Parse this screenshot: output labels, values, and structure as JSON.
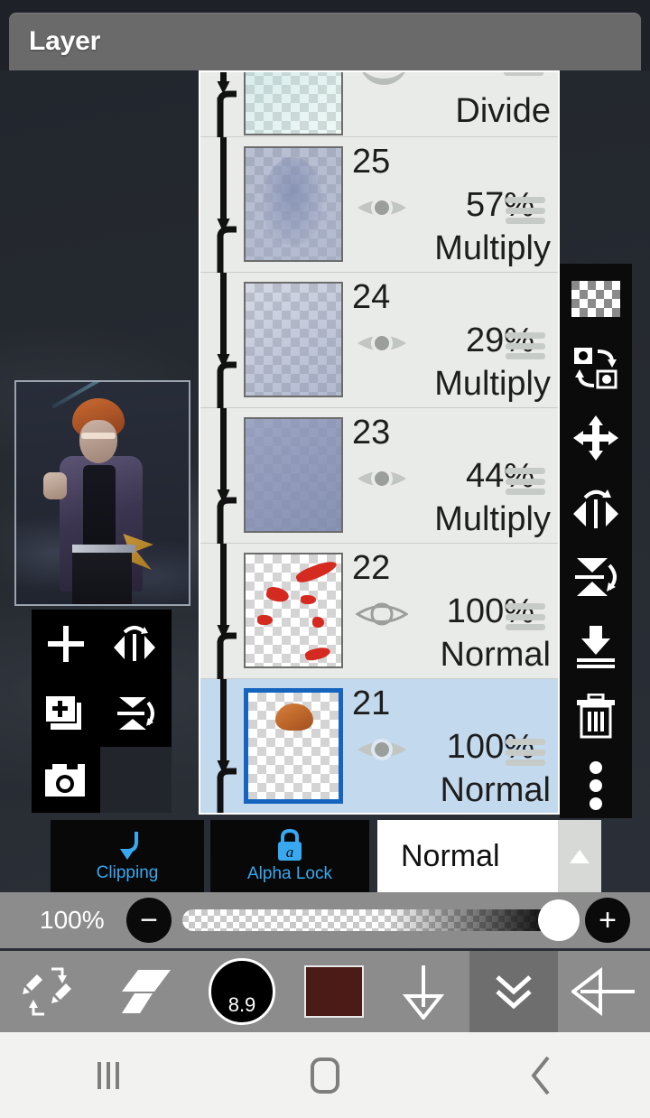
{
  "app": {
    "header_title": "Layer",
    "accent_blue": "#38a9f0",
    "selection_blue": "#1565c0",
    "panel_bg": "#e9ebe9"
  },
  "artwork_preview": {
    "name": "canvas-artwork-preview"
  },
  "float_tools": {
    "items": [
      {
        "name": "add-layer-button",
        "icon": "plus-icon"
      },
      {
        "name": "flip-horizontal-button",
        "icon": "flip-horizontal-icon"
      },
      {
        "name": "duplicate-layer-button",
        "icon": "duplicate-layer-icon"
      },
      {
        "name": "flip-vertical-button",
        "icon": "flip-vertical-icon"
      },
      {
        "name": "camera-button",
        "icon": "camera-icon"
      }
    ]
  },
  "layers": [
    {
      "number": "",
      "opacity": "",
      "blend": "Divide",
      "visible": true,
      "selected": false,
      "partial": true,
      "thumb_style": "tint-teal"
    },
    {
      "number": "25",
      "opacity": "57%",
      "blend": "Multiply",
      "visible": true,
      "selected": false,
      "partial": false,
      "thumb_style": "tint-blue"
    },
    {
      "number": "24",
      "opacity": "29%",
      "blend": "Multiply",
      "visible": true,
      "selected": false,
      "partial": false,
      "thumb_style": "tint-blue2"
    },
    {
      "number": "23",
      "opacity": "44%",
      "blend": "Multiply",
      "visible": true,
      "selected": false,
      "partial": false,
      "thumb_style": "tint-blue3"
    },
    {
      "number": "22",
      "opacity": "100%",
      "blend": "Normal",
      "visible": false,
      "selected": false,
      "partial": false,
      "thumb_style": "splats"
    },
    {
      "number": "21",
      "opacity": "100%",
      "blend": "Normal",
      "visible": true,
      "selected": true,
      "partial": false,
      "thumb_style": "hair"
    }
  ],
  "right_toolbar": {
    "items": [
      {
        "name": "transparency-checker-button",
        "icon": "checkerboard-icon"
      },
      {
        "name": "swap-layer-button",
        "icon": "swap-layers-icon"
      },
      {
        "name": "move-layer-button",
        "icon": "move-arrows-icon"
      },
      {
        "name": "rotate-flip-horizontal-button",
        "icon": "flip-horizontal-icon"
      },
      {
        "name": "rotate-flip-vertical-button",
        "icon": "flip-vertical-icon"
      },
      {
        "name": "merge-down-button",
        "icon": "merge-down-icon"
      },
      {
        "name": "delete-layer-button",
        "icon": "trash-icon"
      },
      {
        "name": "more-options-button",
        "icon": "more-vertical-icon"
      }
    ]
  },
  "mode_row": {
    "clipping_label": "Clipping",
    "alpha_lock_label": "Alpha Lock",
    "blend_mode_value": "Normal"
  },
  "opacity_bar": {
    "percent": "100%",
    "minus_label": "−",
    "plus_label": "+"
  },
  "bottom_toolbar": {
    "brush_size": "8.9",
    "color_swatch_hex": "#4a1b17",
    "items": [
      {
        "name": "brush-eraser-swap-button",
        "icon": "brush-swap-icon"
      },
      {
        "name": "eraser-tool-button",
        "icon": "eraser-icon"
      },
      {
        "name": "brush-size-button",
        "icon": "brush-size-icon"
      },
      {
        "name": "color-swatch-button",
        "icon": "color-swatch-icon"
      },
      {
        "name": "download-arrow-button",
        "icon": "arrow-down-icon"
      },
      {
        "name": "collapse-panel-button",
        "icon": "double-chevron-down-icon"
      },
      {
        "name": "back-button",
        "icon": "arrow-left-icon"
      }
    ]
  },
  "nav_bar": {
    "items": [
      {
        "name": "nav-recents-button",
        "icon": "recents-icon"
      },
      {
        "name": "nav-home-button",
        "icon": "home-icon"
      },
      {
        "name": "nav-back-button",
        "icon": "back-chevron-icon"
      }
    ]
  }
}
